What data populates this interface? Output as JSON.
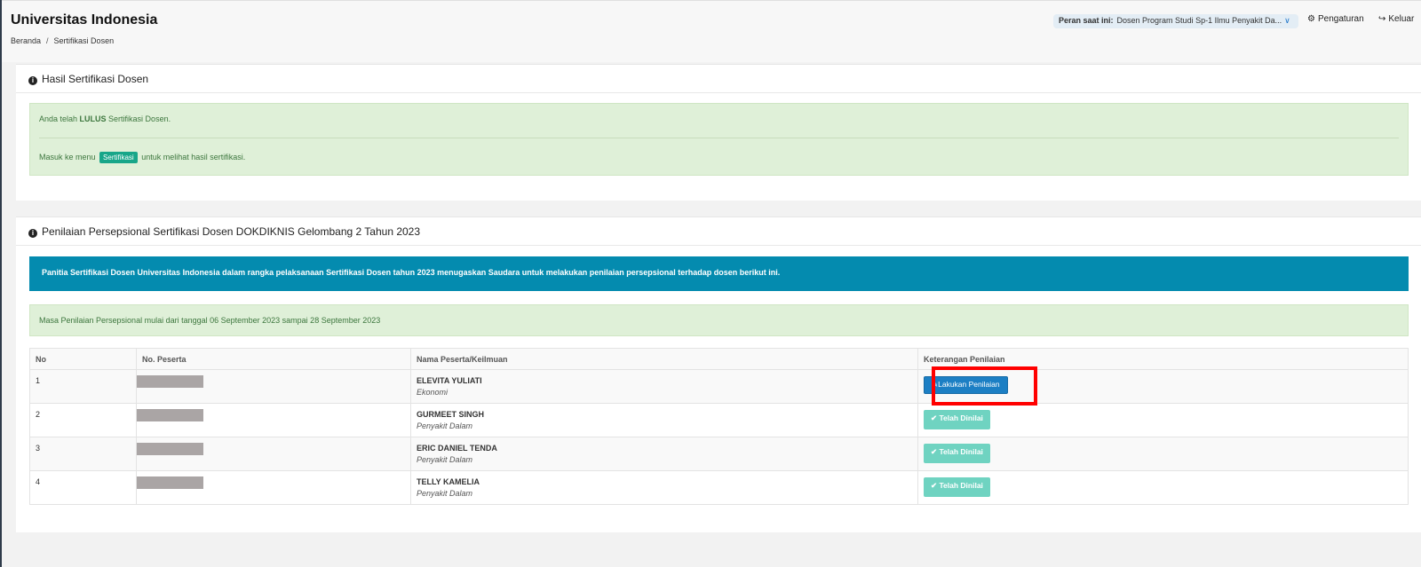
{
  "header": {
    "app_title": "Universitas Indonesia",
    "breadcrumb": {
      "home": "Beranda",
      "sep": "/",
      "current": "Sertifikasi Dosen"
    },
    "role": {
      "label": "Peran saat ini:",
      "value": "Dosen Program Studi Sp-1 Ilmu Penyakit Da..."
    },
    "settings_label": "Pengaturan",
    "logout_label": "Keluar"
  },
  "hasil_panel": {
    "title": "Hasil Sertifikasi Dosen",
    "line1_pre": "Anda telah ",
    "line1_bold": "LULUS",
    "line1_post": " Sertifikasi Dosen.",
    "line2_pre": "Masuk ke menu ",
    "line2_badge": "Sertifikasi",
    "line2_post": " untuk melihat hasil sertifikasi."
  },
  "penilaian_panel": {
    "title": "Penilaian Persepsional Sertifikasi Dosen DOKDIKNIS Gelombang 2 Tahun 2023",
    "info_text": "Panitia Sertifikasi Dosen Universitas Indonesia dalam rangka pelaksanaan Sertifikasi Dosen tahun 2023 menugaskan Saudara untuk melakukan penilaian persepsional terhadap dosen berikut ini.",
    "masa_text": "Masa Penilaian Persepsional mulai dari tanggal 06 September 2023 sampai 28 September 2023",
    "table": {
      "headers": [
        "No",
        "No. Peserta",
        "Nama Peserta/Keilmuan",
        "Keterangan Penilaian"
      ],
      "rows": [
        {
          "no": "1",
          "nama": "ELEVITA YULIATI",
          "ilmu": "Ekonomi",
          "action": "Lakukan Penilaian"
        },
        {
          "no": "2",
          "nama": "GURMEET SINGH",
          "ilmu": "Penyakit Dalam",
          "action": "Telah Dinilai"
        },
        {
          "no": "3",
          "nama": "ERIC DANIEL TENDA",
          "ilmu": "Penyakit Dalam",
          "action": "Telah Dinilai"
        },
        {
          "no": "4",
          "nama": "TELLY KAMELIA",
          "ilmu": "Penyakit Dalam",
          "action": "Telah Dinilai"
        }
      ]
    }
  },
  "colors": {
    "info_blue": "#048baf",
    "success_bg": "#dff0d8",
    "primary_button": "#1c7fc4",
    "done_button": "#6fd3c1",
    "highlight": "#ff0000"
  },
  "icons": {
    "settings": "gear-icon",
    "logout": "sign-out-icon",
    "panel": "info-circle-icon",
    "edit": "pencil-icon",
    "done": "check-icon",
    "role_dropdown": "chevron-down-icon"
  }
}
